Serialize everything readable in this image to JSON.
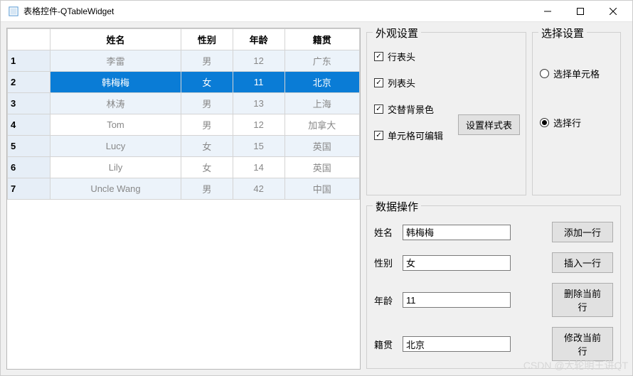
{
  "window": {
    "title": "表格控件-QTableWidget"
  },
  "table": {
    "headers": [
      "姓名",
      "性别",
      "年龄",
      "籍贯"
    ],
    "row_labels": [
      "1",
      "2",
      "3",
      "4",
      "5",
      "6",
      "7"
    ],
    "selected_index": 1,
    "rows": [
      {
        "name": "李雷",
        "gender": "男",
        "age": "12",
        "place": "广东"
      },
      {
        "name": "韩梅梅",
        "gender": "女",
        "age": "11",
        "place": "北京"
      },
      {
        "name": "林涛",
        "gender": "男",
        "age": "13",
        "place": "上海"
      },
      {
        "name": "Tom",
        "gender": "男",
        "age": "12",
        "place": "加拿大"
      },
      {
        "name": "Lucy",
        "gender": "女",
        "age": "15",
        "place": "英国"
      },
      {
        "name": "Lily",
        "gender": "女",
        "age": "14",
        "place": "英国"
      },
      {
        "name": "Uncle Wang",
        "gender": "男",
        "age": "42",
        "place": "中国"
      }
    ]
  },
  "appearance": {
    "title": "外观设置",
    "row_header": {
      "label": "行表头",
      "checked": true
    },
    "col_header": {
      "label": "列表头",
      "checked": true
    },
    "alt_bg": {
      "label": "交替背景色",
      "checked": true
    },
    "editable": {
      "label": "单元格可编辑",
      "checked": true
    },
    "style_btn": "设置样式表"
  },
  "selection": {
    "title": "选择设置",
    "cell": {
      "label": "选择单元格",
      "checked": false
    },
    "row": {
      "label": "选择行",
      "checked": true
    }
  },
  "dataop": {
    "title": "数据操作",
    "name": {
      "label": "姓名",
      "value": "韩梅梅"
    },
    "gender": {
      "label": "性别",
      "value": "女"
    },
    "age": {
      "label": "年龄",
      "value": "11"
    },
    "place": {
      "label": "籍贯",
      "value": "北京"
    },
    "add_btn": "添加一行",
    "insert_btn": "插入一行",
    "delete_btn": "删除当前行",
    "modify_btn": "修改当前行"
  },
  "watermark": "CSDN @大轮明王讲QT"
}
